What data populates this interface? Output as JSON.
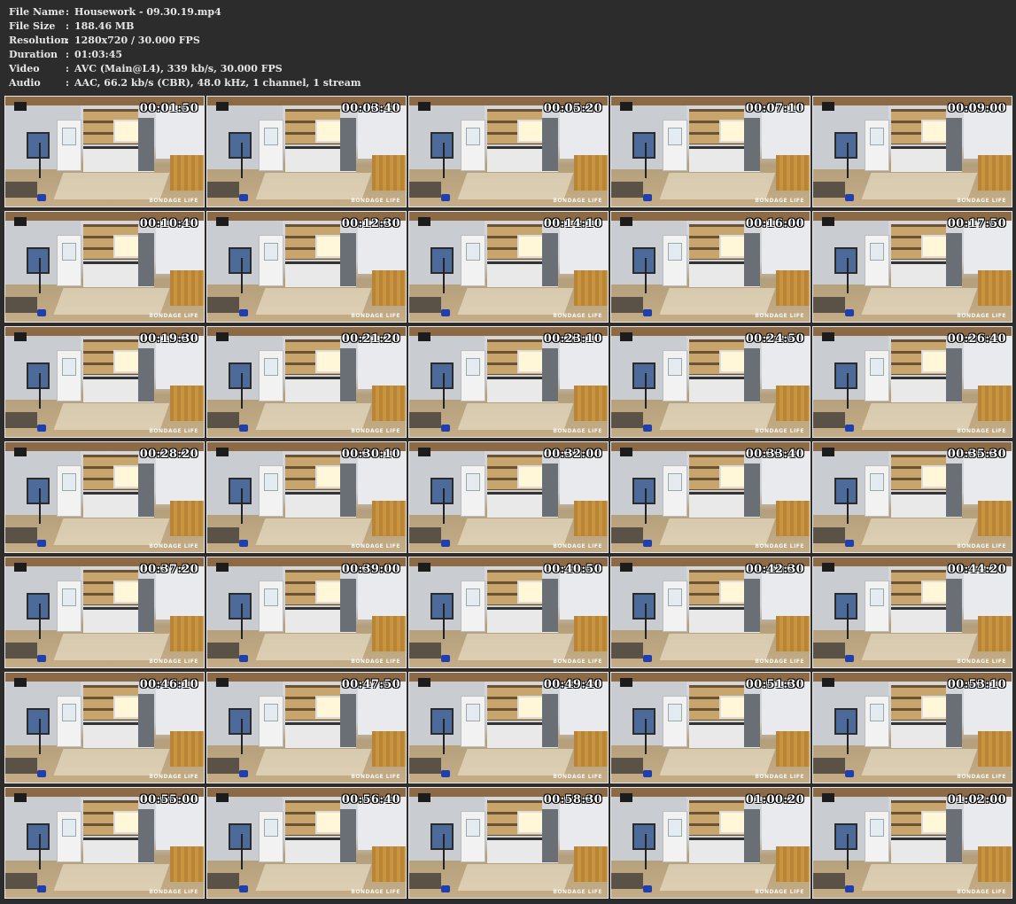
{
  "info": [
    {
      "key": "File Name",
      "sep": ":",
      "value": "Housework - 09.30.19.mp4"
    },
    {
      "key": "File Size",
      "sep": ":",
      "value": "188.46 MB"
    },
    {
      "key": "Resolution",
      "sep": ":",
      "value": "1280x720 / 30.000 FPS"
    },
    {
      "key": "Duration",
      "sep": ":",
      "value": "01:03:45"
    },
    {
      "key": "Video",
      "sep": ":",
      "value": "AVC (Main@L4), 339 kb/s, 30.000 FPS"
    },
    {
      "key": "Audio",
      "sep": ":",
      "value": "AAC, 66.2 kb/s (CBR), 48.0 kHz, 1 channel, 1 stream"
    }
  ],
  "watermark": "BONDAGE LIFE",
  "timestamps": [
    "00:01:50",
    "00:03:40",
    "00:05:20",
    "00:07:10",
    "00:09:00",
    "00:10:40",
    "00:12:30",
    "00:14:10",
    "00:16:00",
    "00:17:50",
    "00:19:30",
    "00:21:20",
    "00:23:10",
    "00:24:50",
    "00:26:40",
    "00:28:20",
    "00:30:10",
    "00:32:00",
    "00:33:40",
    "00:35:30",
    "00:37:20",
    "00:39:00",
    "00:40:50",
    "00:42:30",
    "00:44:20",
    "00:46:10",
    "00:47:50",
    "00:49:40",
    "00:51:30",
    "00:53:10",
    "00:55:00",
    "00:56:40",
    "00:58:30",
    "01:00:20",
    "01:02:00"
  ]
}
